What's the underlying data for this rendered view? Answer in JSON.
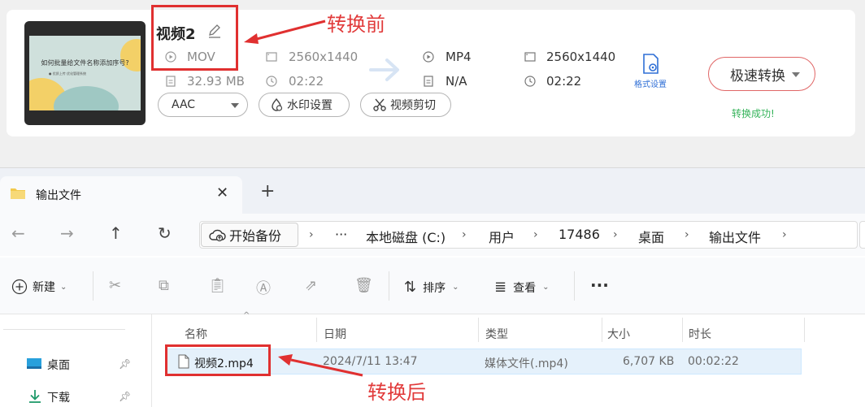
{
  "converter": {
    "thumbnail": {
      "title": "如何批量给文件名称添加序号?",
      "subtitle": "● 优质上传 优化管理系统"
    },
    "file_name": "视频2",
    "source": {
      "format": "MOV",
      "resolution": "2560x1440",
      "size": "32.93 MB",
      "duration": "02:22"
    },
    "target": {
      "format": "MP4",
      "resolution": "2560x1440",
      "size": "N/A",
      "duration": "02:22"
    },
    "codec_select": "AAC",
    "watermark_label": "水印设置",
    "clip_label": "视频剪切",
    "format_settings_label": "格式设置",
    "convert_button_label": "极速转换",
    "status": "转换成功!",
    "colors": {
      "accent_blue": "#2f6fd6",
      "success": "#35b35a",
      "annotation_red": "#e03030"
    }
  },
  "annotations": {
    "before": "转换前",
    "after": "转换后"
  },
  "explorer": {
    "tab_title": "输出文件",
    "new_tab": "+",
    "backup_label": "开始备份",
    "breadcrumb": [
      "本地磁盘 (C:)",
      "用户",
      "17486",
      "桌面",
      "输出文件"
    ],
    "breadcrumb_more": "···",
    "commands": {
      "new_label": "新建",
      "sort_label": "排序",
      "view_label": "查看",
      "more": "···"
    },
    "nav_items": [
      {
        "label": "桌面",
        "icon": "desktop-icon"
      },
      {
        "label": "下载",
        "icon": "download-icon"
      }
    ],
    "columns": [
      "名称",
      "日期",
      "类型",
      "大小",
      "时长"
    ],
    "files": [
      {
        "name": "视频2.mp4",
        "date": "2024/7/11 13:47",
        "type": "媒体文件(.mp4)",
        "size": "6,707 KB",
        "duration": "00:02:22"
      }
    ]
  }
}
